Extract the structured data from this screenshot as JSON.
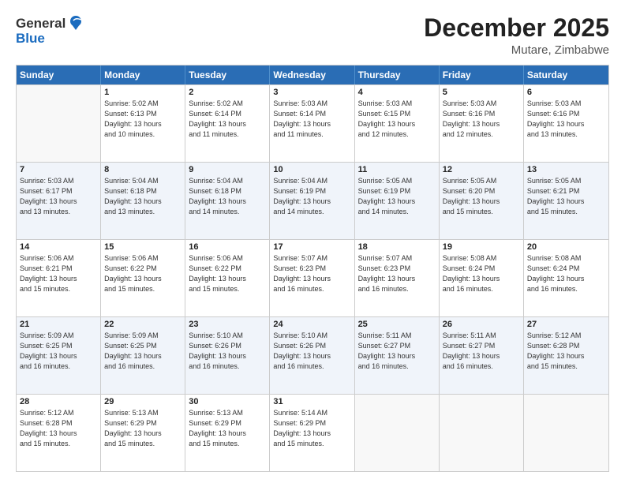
{
  "logo": {
    "general": "General",
    "blue": "Blue"
  },
  "title": "December 2025",
  "location": "Mutare, Zimbabwe",
  "days": [
    "Sunday",
    "Monday",
    "Tuesday",
    "Wednesday",
    "Thursday",
    "Friday",
    "Saturday"
  ],
  "rows": [
    [
      {
        "day": "",
        "lines": []
      },
      {
        "day": "1",
        "lines": [
          "Sunrise: 5:02 AM",
          "Sunset: 6:13 PM",
          "Daylight: 13 hours",
          "and 10 minutes."
        ]
      },
      {
        "day": "2",
        "lines": [
          "Sunrise: 5:02 AM",
          "Sunset: 6:14 PM",
          "Daylight: 13 hours",
          "and 11 minutes."
        ]
      },
      {
        "day": "3",
        "lines": [
          "Sunrise: 5:03 AM",
          "Sunset: 6:14 PM",
          "Daylight: 13 hours",
          "and 11 minutes."
        ]
      },
      {
        "day": "4",
        "lines": [
          "Sunrise: 5:03 AM",
          "Sunset: 6:15 PM",
          "Daylight: 13 hours",
          "and 12 minutes."
        ]
      },
      {
        "day": "5",
        "lines": [
          "Sunrise: 5:03 AM",
          "Sunset: 6:16 PM",
          "Daylight: 13 hours",
          "and 12 minutes."
        ]
      },
      {
        "day": "6",
        "lines": [
          "Sunrise: 5:03 AM",
          "Sunset: 6:16 PM",
          "Daylight: 13 hours",
          "and 13 minutes."
        ]
      }
    ],
    [
      {
        "day": "7",
        "lines": [
          "Sunrise: 5:03 AM",
          "Sunset: 6:17 PM",
          "Daylight: 13 hours",
          "and 13 minutes."
        ]
      },
      {
        "day": "8",
        "lines": [
          "Sunrise: 5:04 AM",
          "Sunset: 6:18 PM",
          "Daylight: 13 hours",
          "and 13 minutes."
        ]
      },
      {
        "day": "9",
        "lines": [
          "Sunrise: 5:04 AM",
          "Sunset: 6:18 PM",
          "Daylight: 13 hours",
          "and 14 minutes."
        ]
      },
      {
        "day": "10",
        "lines": [
          "Sunrise: 5:04 AM",
          "Sunset: 6:19 PM",
          "Daylight: 13 hours",
          "and 14 minutes."
        ]
      },
      {
        "day": "11",
        "lines": [
          "Sunrise: 5:05 AM",
          "Sunset: 6:19 PM",
          "Daylight: 13 hours",
          "and 14 minutes."
        ]
      },
      {
        "day": "12",
        "lines": [
          "Sunrise: 5:05 AM",
          "Sunset: 6:20 PM",
          "Daylight: 13 hours",
          "and 15 minutes."
        ]
      },
      {
        "day": "13",
        "lines": [
          "Sunrise: 5:05 AM",
          "Sunset: 6:21 PM",
          "Daylight: 13 hours",
          "and 15 minutes."
        ]
      }
    ],
    [
      {
        "day": "14",
        "lines": [
          "Sunrise: 5:06 AM",
          "Sunset: 6:21 PM",
          "Daylight: 13 hours",
          "and 15 minutes."
        ]
      },
      {
        "day": "15",
        "lines": [
          "Sunrise: 5:06 AM",
          "Sunset: 6:22 PM",
          "Daylight: 13 hours",
          "and 15 minutes."
        ]
      },
      {
        "day": "16",
        "lines": [
          "Sunrise: 5:06 AM",
          "Sunset: 6:22 PM",
          "Daylight: 13 hours",
          "and 15 minutes."
        ]
      },
      {
        "day": "17",
        "lines": [
          "Sunrise: 5:07 AM",
          "Sunset: 6:23 PM",
          "Daylight: 13 hours",
          "and 16 minutes."
        ]
      },
      {
        "day": "18",
        "lines": [
          "Sunrise: 5:07 AM",
          "Sunset: 6:23 PM",
          "Daylight: 13 hours",
          "and 16 minutes."
        ]
      },
      {
        "day": "19",
        "lines": [
          "Sunrise: 5:08 AM",
          "Sunset: 6:24 PM",
          "Daylight: 13 hours",
          "and 16 minutes."
        ]
      },
      {
        "day": "20",
        "lines": [
          "Sunrise: 5:08 AM",
          "Sunset: 6:24 PM",
          "Daylight: 13 hours",
          "and 16 minutes."
        ]
      }
    ],
    [
      {
        "day": "21",
        "lines": [
          "Sunrise: 5:09 AM",
          "Sunset: 6:25 PM",
          "Daylight: 13 hours",
          "and 16 minutes."
        ]
      },
      {
        "day": "22",
        "lines": [
          "Sunrise: 5:09 AM",
          "Sunset: 6:25 PM",
          "Daylight: 13 hours",
          "and 16 minutes."
        ]
      },
      {
        "day": "23",
        "lines": [
          "Sunrise: 5:10 AM",
          "Sunset: 6:26 PM",
          "Daylight: 13 hours",
          "and 16 minutes."
        ]
      },
      {
        "day": "24",
        "lines": [
          "Sunrise: 5:10 AM",
          "Sunset: 6:26 PM",
          "Daylight: 13 hours",
          "and 16 minutes."
        ]
      },
      {
        "day": "25",
        "lines": [
          "Sunrise: 5:11 AM",
          "Sunset: 6:27 PM",
          "Daylight: 13 hours",
          "and 16 minutes."
        ]
      },
      {
        "day": "26",
        "lines": [
          "Sunrise: 5:11 AM",
          "Sunset: 6:27 PM",
          "Daylight: 13 hours",
          "and 16 minutes."
        ]
      },
      {
        "day": "27",
        "lines": [
          "Sunrise: 5:12 AM",
          "Sunset: 6:28 PM",
          "Daylight: 13 hours",
          "and 15 minutes."
        ]
      }
    ],
    [
      {
        "day": "28",
        "lines": [
          "Sunrise: 5:12 AM",
          "Sunset: 6:28 PM",
          "Daylight: 13 hours",
          "and 15 minutes."
        ]
      },
      {
        "day": "29",
        "lines": [
          "Sunrise: 5:13 AM",
          "Sunset: 6:29 PM",
          "Daylight: 13 hours",
          "and 15 minutes."
        ]
      },
      {
        "day": "30",
        "lines": [
          "Sunrise: 5:13 AM",
          "Sunset: 6:29 PM",
          "Daylight: 13 hours",
          "and 15 minutes."
        ]
      },
      {
        "day": "31",
        "lines": [
          "Sunrise: 5:14 AM",
          "Sunset: 6:29 PM",
          "Daylight: 13 hours",
          "and 15 minutes."
        ]
      },
      {
        "day": "",
        "lines": []
      },
      {
        "day": "",
        "lines": []
      },
      {
        "day": "",
        "lines": []
      }
    ]
  ]
}
